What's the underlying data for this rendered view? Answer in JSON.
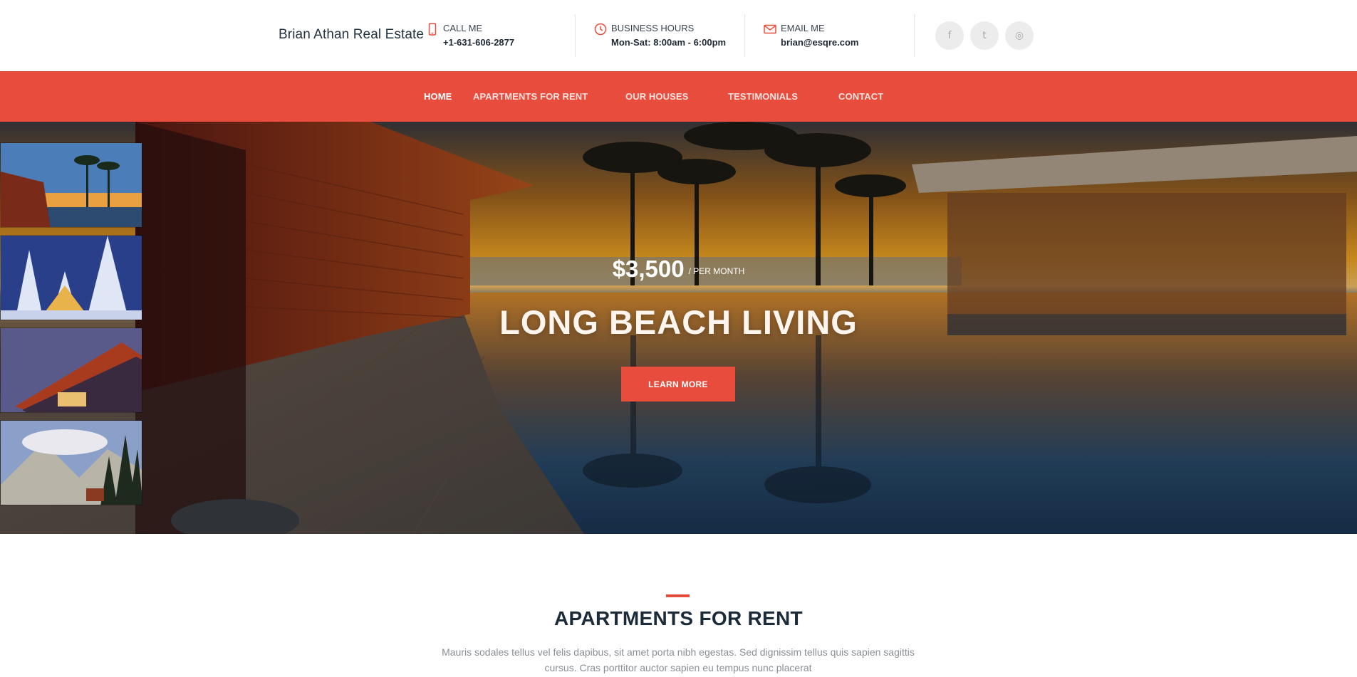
{
  "header": {
    "brand": "Brian Athan Real Estate",
    "call": {
      "label": "CALL ME",
      "value": "+1-631-606-2877",
      "icon": "phone-icon"
    },
    "hours": {
      "label": "BUSINESS HOURS",
      "value": "Mon-Sat: 8:00am - 6:00pm",
      "icon": "clock-icon"
    },
    "email": {
      "label": "EMAIL ME",
      "value": "brian@esqre.com",
      "icon": "envelope-icon"
    },
    "social": [
      {
        "name": "facebook-icon",
        "glyph": "f"
      },
      {
        "name": "twitter-icon",
        "glyph": "t"
      },
      {
        "name": "instagram-icon",
        "glyph": "◎"
      }
    ]
  },
  "nav": {
    "items": [
      "HOME",
      "APARTMENTS FOR RENT",
      "OUR HOUSES",
      "TESTIMONIALS",
      "CONTACT"
    ],
    "active": "HOME"
  },
  "hero": {
    "price": "$3,500",
    "price_suffix": "/ PER MONTH",
    "headline": "LONG BEACH LIVING",
    "cta": "LEARN MORE"
  },
  "section": {
    "title": "APARTMENTS FOR RENT",
    "text": "Mauris sodales tellus vel felis dapibus, sit amet porta nibh egestas. Sed dignissim tellus quis sapien sagittis cursus. Cras porttitor auctor sapien eu tempus nunc placerat"
  },
  "colors": {
    "accent": "#e74c3c",
    "dark": "#1c2b3a",
    "muted": "#8a8f95"
  }
}
